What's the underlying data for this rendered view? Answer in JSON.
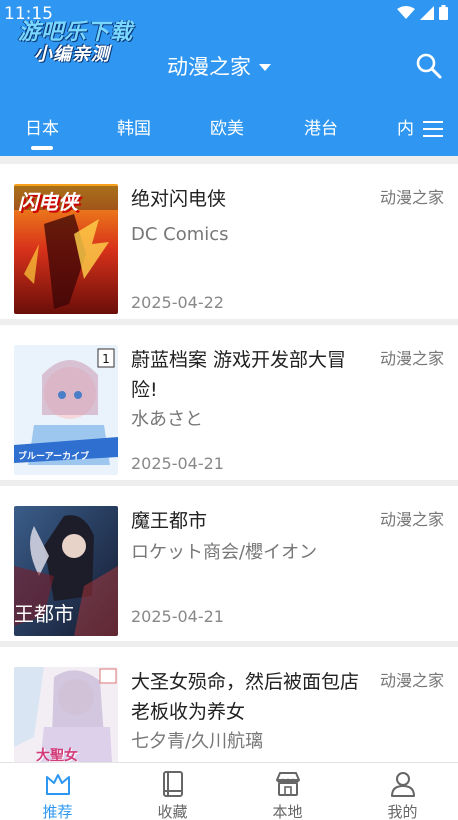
{
  "status": {
    "time": "11:15"
  },
  "watermark": {
    "line1": "游吧乐下载",
    "line2": "小编亲测"
  },
  "header": {
    "title": "动漫之家",
    "accent": "#2f97f1"
  },
  "tabs": [
    {
      "label": "日本",
      "active": true
    },
    {
      "label": "韩国"
    },
    {
      "label": "欧美"
    },
    {
      "label": "港台"
    },
    {
      "label": "内"
    }
  ],
  "items": [
    {
      "title": "绝对闪电侠",
      "author": "DC Comics",
      "date": "2025-04-22",
      "source": "动漫之家",
      "cover_text": "闪电侠"
    },
    {
      "title": "蔚蓝档案 游戏开发部大冒险!",
      "author": "水あさと",
      "date": "2025-04-21",
      "source": "动漫之家",
      "cover_text": "ブルーアーカイブ"
    },
    {
      "title": "魔王都市",
      "author": "ロケット商会/櫻イオン",
      "date": "2025-04-21",
      "source": "动漫之家",
      "cover_text": "王都市"
    },
    {
      "title": "大圣女殒命，然后被面包店老板收为养女",
      "author": "七夕青/久川航璃",
      "date": "",
      "source": "动漫之家",
      "cover_text": "大聖女"
    }
  ],
  "nav": [
    {
      "label": "推荐",
      "icon": "crown-icon",
      "active": true
    },
    {
      "label": "收藏",
      "icon": "book-icon"
    },
    {
      "label": "本地",
      "icon": "store-icon"
    },
    {
      "label": "我的",
      "icon": "user-icon"
    }
  ]
}
